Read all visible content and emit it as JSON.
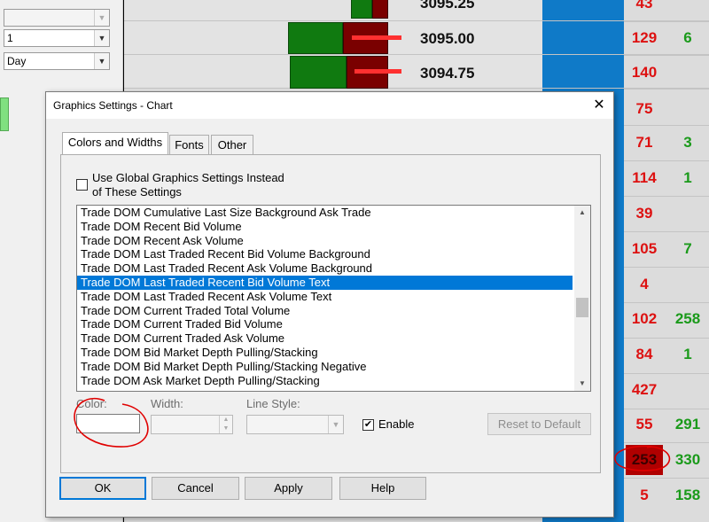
{
  "left_panel": {
    "combo_top_value": "",
    "combo_interval_value": "1",
    "combo_unit_value": "Day"
  },
  "ladder": {
    "rows": [
      {
        "price": "3095.25",
        "vol": "43",
        "vol2": ""
      },
      {
        "price": "3095.00",
        "vol": "129",
        "vol2": "6"
      },
      {
        "price": "3094.75",
        "vol": "140",
        "vol2": ""
      }
    ],
    "right_rows": [
      {
        "vol": "75",
        "vol2": ""
      },
      {
        "vol": "71",
        "vol2": "3"
      },
      {
        "vol": "114",
        "vol2": "1"
      },
      {
        "vol": "39",
        "vol2": ""
      },
      {
        "vol": "105",
        "vol2": "7"
      },
      {
        "vol": "4",
        "vol2": ""
      },
      {
        "vol": "102",
        "vol2": "258"
      },
      {
        "vol": "84",
        "vol2": "1"
      },
      {
        "vol": "427",
        "vol2": ""
      },
      {
        "vol": "55",
        "vol2": "291"
      },
      {
        "vol": "253",
        "vol2": "330"
      },
      {
        "vol": "5",
        "vol2": "158"
      }
    ]
  },
  "dialog": {
    "title": "Graphics Settings  - Chart",
    "tabs": [
      "Colors and Widths",
      "Fonts",
      "Other"
    ],
    "global_checkbox_line1": "Use Global Graphics Settings Instead",
    "global_checkbox_line2": "of These Settings",
    "list_items": [
      "Trade DOM Cumulative Last Size Background Ask Trade",
      "Trade DOM Recent Bid Volume",
      "Trade DOM Recent Ask Volume",
      "Trade DOM Last Traded Recent Bid Volume Background",
      "Trade DOM Last Traded Recent Ask Volume Background",
      "Trade DOM Last Traded Recent Bid Volume Text",
      "Trade DOM Last Traded Recent Ask Volume Text",
      "Trade DOM Current Traded Total Volume",
      "Trade DOM Current Traded Bid Volume",
      "Trade DOM Current Traded Ask Volume",
      "Trade DOM Bid Market Depth Pulling/Stacking",
      "Trade DOM Bid Market Depth Pulling/Stacking Negative",
      "Trade DOM Ask Market Depth Pulling/Stacking"
    ],
    "color_label": "Color:",
    "width_label": "Width:",
    "line_style_label": "Line Style:",
    "enable_label": "Enable",
    "enable_checked": "✔",
    "reset_label": "Reset to Default",
    "ok_label": "OK",
    "cancel_label": "Cancel",
    "apply_label": "Apply",
    "help_label": "Help",
    "close_glyph": "✕"
  },
  "colors": {
    "selection": "#0078d7",
    "bid_volume": "#d11111",
    "ask_volume": "#1a9a1a",
    "annotation": "#e00000"
  }
}
